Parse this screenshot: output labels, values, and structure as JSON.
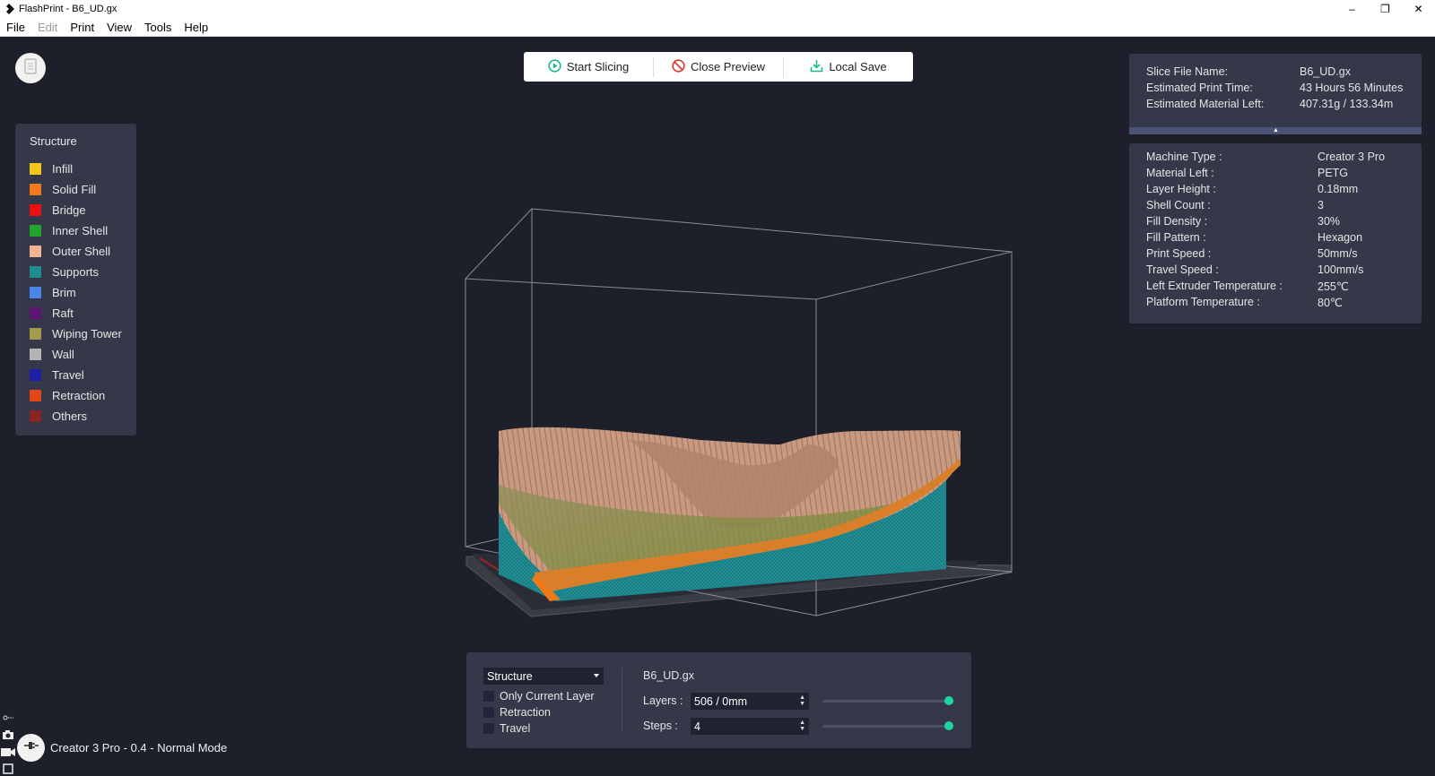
{
  "window": {
    "title": "FlashPrint - B6_UD.gx",
    "minimize": "–",
    "maximize": "❐",
    "close": "✕"
  },
  "menu": [
    {
      "label": "File",
      "enabled": true
    },
    {
      "label": "Edit",
      "enabled": false
    },
    {
      "label": "Print",
      "enabled": true
    },
    {
      "label": "View",
      "enabled": true
    },
    {
      "label": "Tools",
      "enabled": true
    },
    {
      "label": "Help",
      "enabled": true
    }
  ],
  "toolbar": {
    "start_slicing": "Start Slicing",
    "close_preview": "Close Preview",
    "local_save": "Local Save",
    "accent": "#1bb98a",
    "danger": "#e0342a"
  },
  "legend": {
    "title": "Structure",
    "items": [
      {
        "label": "Infill",
        "color": "#f5c518"
      },
      {
        "label": "Solid Fill",
        "color": "#f07a1a"
      },
      {
        "label": "Bridge",
        "color": "#e81010"
      },
      {
        "label": "Inner Shell",
        "color": "#23a52a"
      },
      {
        "label": "Outer Shell",
        "color": "#f2b493"
      },
      {
        "label": "Supports",
        "color": "#1e8d8f"
      },
      {
        "label": "Brim",
        "color": "#4a86e8"
      },
      {
        "label": "Raft",
        "color": "#5a1670"
      },
      {
        "label": "Wiping Tower",
        "color": "#a39a4c"
      },
      {
        "label": "Wall",
        "color": "#b3b3b3"
      },
      {
        "label": "Travel",
        "color": "#1f1fa8"
      },
      {
        "label": "Retraction",
        "color": "#e04818"
      },
      {
        "label": "Others",
        "color": "#8a2424"
      }
    ]
  },
  "slice_info": [
    {
      "key": "Slice File Name:",
      "value": "B6_UD.gx"
    },
    {
      "key": "Estimated Print Time:",
      "value": "43 Hours 56 Minutes"
    },
    {
      "key": "Estimated Material Left:",
      "value": "407.31g / 133.34m"
    }
  ],
  "machine_info": [
    {
      "key": "Machine Type :",
      "value": "Creator 3 Pro"
    },
    {
      "key": "Material Left :",
      "value": "PETG"
    },
    {
      "key": "Layer Height :",
      "value": "0.18mm"
    },
    {
      "key": "Shell Count :",
      "value": "3"
    },
    {
      "key": "Fill Density :",
      "value": "30%"
    },
    {
      "key": "Fill Pattern :",
      "value": "Hexagon"
    },
    {
      "key": "Print Speed :",
      "value": "50mm/s"
    },
    {
      "key": "Travel Speed :",
      "value": "100mm/s"
    },
    {
      "key": "Left Extruder Temperature :",
      "value": "255℃"
    },
    {
      "key": "Platform Temperature :",
      "value": "80℃"
    }
  ],
  "preview_controls": {
    "mode_select": "Structure",
    "checkboxes": [
      {
        "label": "Only Current Layer",
        "checked": false
      },
      {
        "label": "Retraction",
        "checked": false
      },
      {
        "label": "Travel",
        "checked": false
      }
    ],
    "file_name": "B6_UD.gx",
    "layers_label": "Layers :",
    "layers_value": "506 / 0mm",
    "layers_slider": 1.0,
    "steps_label": "Steps :",
    "steps_value": "4",
    "steps_slider": 1.0
  },
  "status": {
    "machine_mode": "Creator 3 Pro - 0.4 - Normal Mode"
  }
}
